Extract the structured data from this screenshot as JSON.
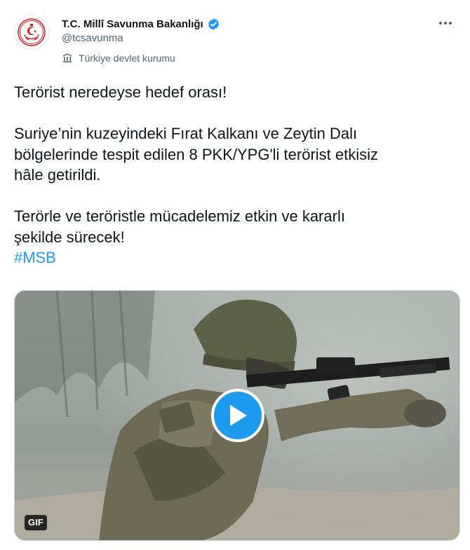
{
  "account": {
    "display_name": "T.C. Millî Savunma Bakanlığı",
    "handle": "@tcsavunma",
    "affiliation": "Türkiye devlet kurumu",
    "verified": true
  },
  "tweet": {
    "line1": "Terörist neredeyse hedef orası!",
    "line2": "Suriye’nin kuzeyindeki  Fırat Kalkanı ve Zeytin Dalı",
    "line3": "bölgelerinde tespit edilen 8 PKK/YPG'li terörist etkisiz",
    "line4": "hâle getirildi.",
    "line5": "Terörle ve teröristle mücadelemiz etkin ve kararlı",
    "line6": "şekilde sürecek!",
    "hashtag": "#MSB"
  },
  "media": {
    "badge": "GIF",
    "play_icon": "play-icon"
  },
  "colors": {
    "text": "#0f1419",
    "secondary": "#536471",
    "accent": "#1d9bf0",
    "verified": "#1d9bf0",
    "emblem_red": "#d71921"
  }
}
